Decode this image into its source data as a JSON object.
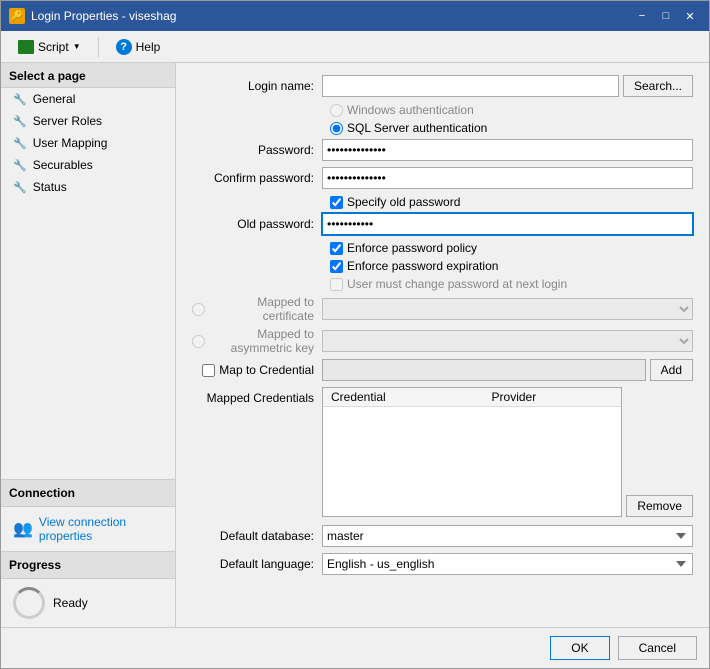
{
  "window": {
    "title": "Login Properties - viseshag",
    "icon": "🔑"
  },
  "titlebar": {
    "minimize_label": "−",
    "restore_label": "□",
    "close_label": "✕"
  },
  "toolbar": {
    "script_label": "Script",
    "help_label": "Help"
  },
  "sidebar": {
    "select_page_label": "Select a page",
    "items": [
      {
        "id": "general",
        "label": "General"
      },
      {
        "id": "server-roles",
        "label": "Server Roles"
      },
      {
        "id": "user-mapping",
        "label": "User Mapping"
      },
      {
        "id": "securables",
        "label": "Securables"
      },
      {
        "id": "status",
        "label": "Status"
      }
    ],
    "connection_label": "Connection",
    "connection_link": "View connection properties",
    "progress_label": "Progress",
    "progress_status": "Ready"
  },
  "form": {
    "login_name_label": "Login name:",
    "login_name_value": "",
    "login_name_placeholder": "",
    "search_button": "Search...",
    "windows_auth_label": "Windows authentication",
    "sql_auth_label": "SQL Server authentication",
    "password_label": "Password:",
    "password_value": "••••••••••••••",
    "confirm_password_label": "Confirm password:",
    "confirm_password_value": "••••••••••••••",
    "specify_old_password_label": "Specify old password",
    "old_password_label": "Old password:",
    "old_password_value": "••••••••••",
    "enforce_policy_label": "Enforce password policy",
    "enforce_expiration_label": "Enforce password expiration",
    "must_change_label": "User must change password at next login",
    "mapped_to_cert_label": "Mapped to certificate",
    "mapped_to_key_label": "Mapped to asymmetric key",
    "map_to_credential_label": "Map to Credential",
    "add_button": "Add",
    "mapped_credentials_label": "Mapped Credentials",
    "credential_col": "Credential",
    "provider_col": "Provider",
    "remove_button": "Remove",
    "default_database_label": "Default database:",
    "default_database_value": "master",
    "default_language_label": "Default language:",
    "default_language_value": "English - us_english"
  },
  "footer": {
    "ok_label": "OK",
    "cancel_label": "Cancel"
  },
  "colors": {
    "accent": "#0078d7",
    "titlebar": "#2b579a"
  }
}
